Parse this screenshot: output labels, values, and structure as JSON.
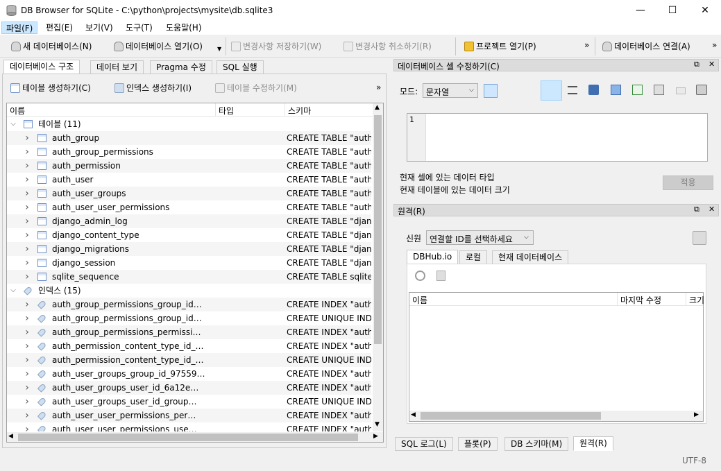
{
  "window": {
    "title": "DB Browser for SQLite - C:\\python\\projects\\mysite\\db.sqlite3",
    "min": "—",
    "max": "☐",
    "close": "✕"
  },
  "menu": [
    "파일(F)",
    "편집(E)",
    "보기(V)",
    "도구(T)",
    "도움말(H)"
  ],
  "toolbar": {
    "new_db": "새 데이터베이스(N)",
    "open_db": "데이터베이스 열기(O)",
    "write_changes": "변경사항 저장하기(W)",
    "revert_changes": "변경사항 취소하기(R)",
    "open_project": "프로젝트 열기(P)",
    "attach_db": "데이터베이스 연결(A)",
    "overflow": "»"
  },
  "main_tabs": [
    "데이터베이스 구조",
    "데이터 보기",
    "Pragma 수정",
    "SQL 실행"
  ],
  "structure_toolbar": {
    "create_table": "테이블 생성하기(C)",
    "create_index": "인덱스 생성하기(I)",
    "modify_table": "테이블 수정하기(M)",
    "overflow": "»"
  },
  "tree": {
    "columns": [
      "이름",
      "타입",
      "스키마"
    ],
    "tables_group": "테이블 (11)",
    "tables": [
      {
        "name": "auth_group",
        "schema": "CREATE TABLE \"auth_group\""
      },
      {
        "name": "auth_group_permissions",
        "schema": "CREATE TABLE \"auth_group_permissions\""
      },
      {
        "name": "auth_permission",
        "schema": "CREATE TABLE \"auth_permission\""
      },
      {
        "name": "auth_user",
        "schema": "CREATE TABLE \"auth_user\""
      },
      {
        "name": "auth_user_groups",
        "schema": "CREATE TABLE \"auth_user_groups\""
      },
      {
        "name": "auth_user_user_permissions",
        "schema": "CREATE TABLE \"auth_user_user_permissions\""
      },
      {
        "name": "django_admin_log",
        "schema": "CREATE TABLE \"django_admin_log\""
      },
      {
        "name": "django_content_type",
        "schema": "CREATE TABLE \"django_content_type\""
      },
      {
        "name": "django_migrations",
        "schema": "CREATE TABLE \"django_migrations\""
      },
      {
        "name": "django_session",
        "schema": "CREATE TABLE \"django_session\""
      },
      {
        "name": "sqlite_sequence",
        "schema": "CREATE TABLE sqlite_sequence"
      }
    ],
    "indexes_group": "인덱스 (15)",
    "indexes": [
      {
        "name": "auth_group_permissions_group_id…",
        "schema": "CREATE INDEX \"auth"
      },
      {
        "name": "auth_group_permissions_group_id…",
        "schema": "CREATE UNIQUE INDEX"
      },
      {
        "name": "auth_group_permissions_permissi…",
        "schema": "CREATE INDEX \"auth"
      },
      {
        "name": "auth_permission_content_type_id_…",
        "schema": "CREATE INDEX \"auth"
      },
      {
        "name": "auth_permission_content_type_id_…",
        "schema": "CREATE UNIQUE INDEX"
      },
      {
        "name": "auth_user_groups_group_id_97559…",
        "schema": "CREATE INDEX \"auth"
      },
      {
        "name": "auth_user_groups_user_id_6a12e…",
        "schema": "CREATE INDEX \"auth"
      },
      {
        "name": "auth_user_groups_user_id_group…",
        "schema": "CREATE UNIQUE INDEX"
      },
      {
        "name": "auth_user_user_permissions_per…",
        "schema": "CREATE INDEX \"auth"
      },
      {
        "name": "auth_user_user_permissions_use…",
        "schema": "CREATE INDEX \"auth"
      }
    ]
  },
  "edit_cell": {
    "title": "데이터베이스 셀 수정하기(C)",
    "mode_label": "모드:",
    "mode_value": "문자열",
    "line_number": "1",
    "type_info": "현재 셀에 있는 데이터 타입",
    "size_info": "현재 테이블에 있는 데이터 크기",
    "apply": "적용"
  },
  "remote": {
    "title": "원격(R)",
    "identity_label": "신원",
    "identity_value": "연결할 ID를 선택하세요",
    "tabs": [
      "DBHub.io",
      "로컬",
      "현재 데이터베이스"
    ],
    "columns": [
      "이름",
      "마지막 수정",
      "크기"
    ]
  },
  "bottom_tabs": [
    "SQL 로그(L)",
    "플롯(P)",
    "DB 스키마(M)",
    "원격(R)"
  ],
  "status": {
    "encoding": "UTF-8"
  },
  "colors": {
    "accent": "#cce8ff",
    "selected_border": "#99d1ff",
    "panel": "#f0f0f0"
  }
}
